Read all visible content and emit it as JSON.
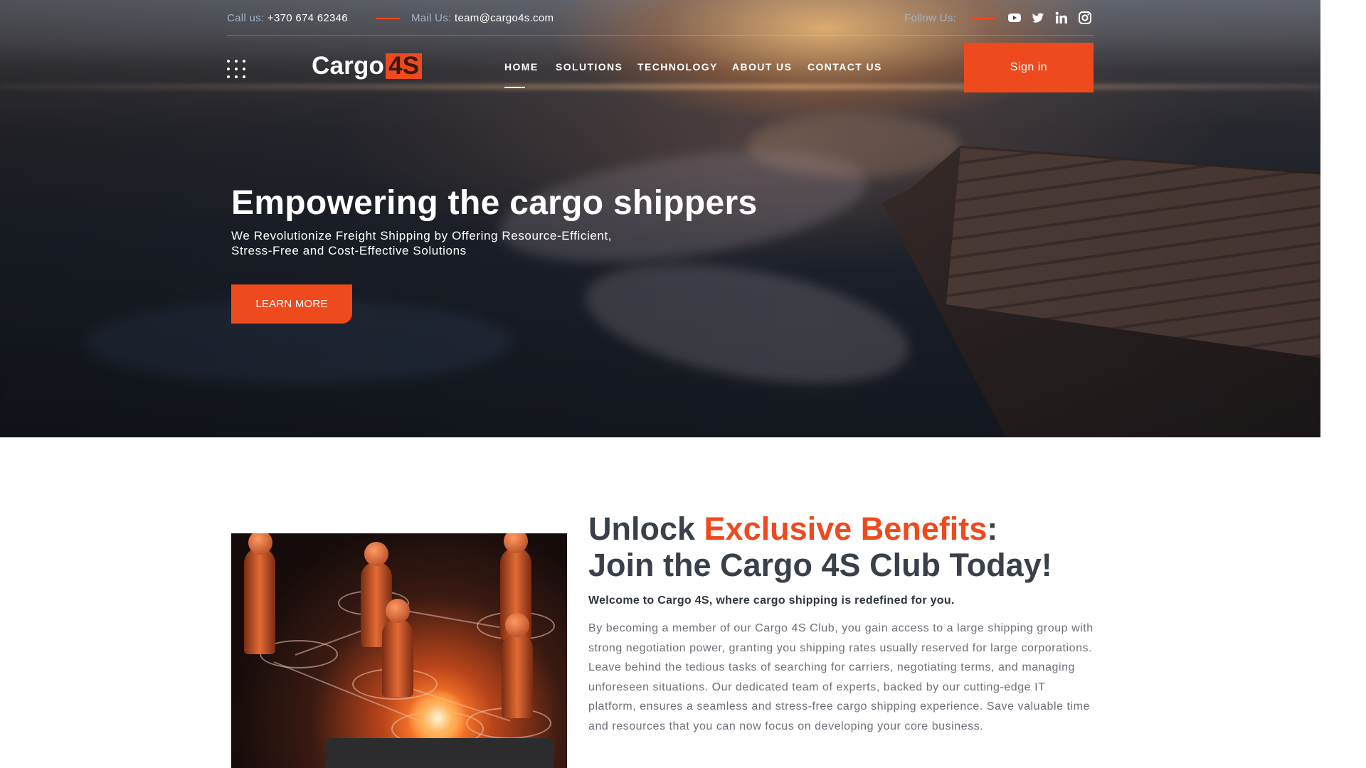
{
  "topbar": {
    "call_label": "Call us:",
    "call_value": "+370 674 62346",
    "mail_label": "Mail Us:",
    "mail_value": "team@cargo4s.com",
    "follow_label": "Follow Us:",
    "social_icons": [
      "youtube-icon",
      "twitter-icon",
      "linkedin-icon",
      "instagram-icon"
    ]
  },
  "header": {
    "logo_text": "Cargo",
    "logo_badge": "4S",
    "nav": [
      "HOME",
      "SOLUTIONS",
      "TECHNOLOGY",
      "ABOUT US",
      "CONTACT US"
    ],
    "active_nav": "HOME",
    "signin_label": "Sign in"
  },
  "hero": {
    "title": "Empowering the cargo shippers",
    "subtitle_line1": "We Revolutionize Freight Shipping by Offering Resource-Efficient,",
    "subtitle_line2": "Stress-Free and Cost-Effective Solutions",
    "cta_label": "LEARN MORE"
  },
  "club": {
    "title_part1": "Unlock ",
    "title_accent": "Exclusive Benefits",
    "title_part2": ":",
    "title_line2": "Join the Cargo 4S Club Today!",
    "welcome": "Welcome to Cargo 4S, where cargo shipping is redefined for you.",
    "body": "By becoming a member of our Cargo 4S Club, you gain access to a large shipping group with strong negotiation power, granting you shipping rates usually reserved for large corporations. Leave behind the tedious tasks of searching for carriers, negotiating terms, and managing unforeseen situations. Our dedicated team of experts, backed by our cutting-edge IT platform, ensures a seamless and stress-free cargo shipping experience. Save valuable time and resources that you can now focus on developing your core business."
  },
  "colors": {
    "accent": "#ee4a1e",
    "heading": "#3a4049",
    "body_text": "#6b7079"
  }
}
